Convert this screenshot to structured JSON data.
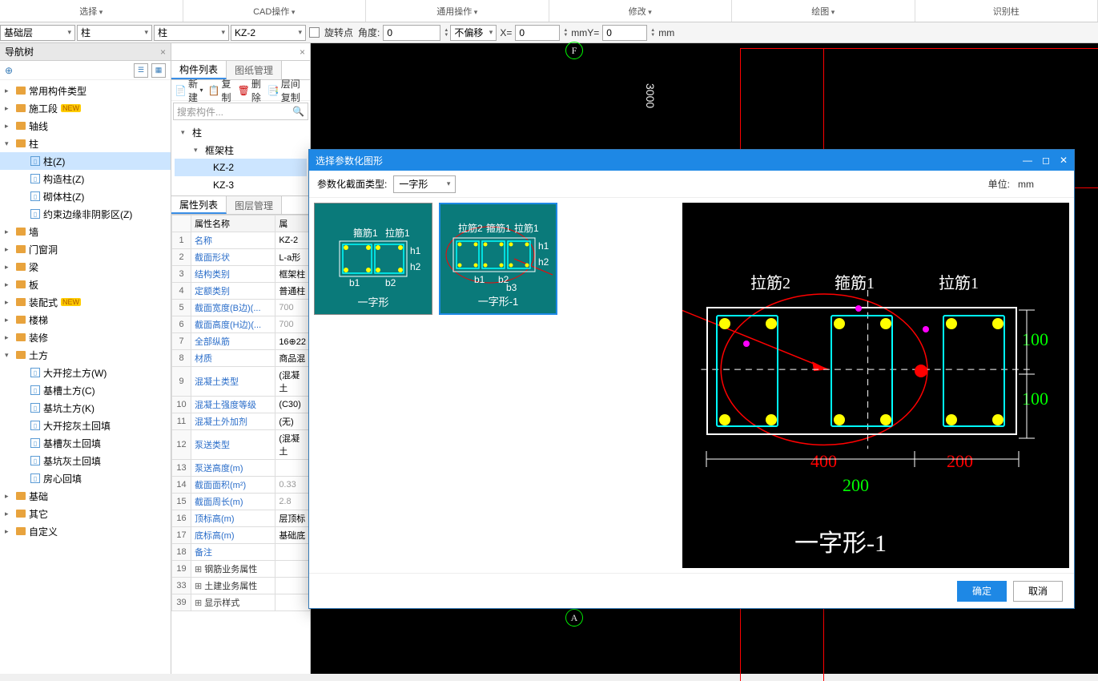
{
  "ribbon": {
    "sections": [
      "选择",
      "CAD操作",
      "通用操作",
      "修改",
      "绘图",
      "识别柱"
    ]
  },
  "toolbar": {
    "combo_floor": "基础层",
    "combo_cat1": "柱",
    "combo_cat2": "柱",
    "combo_comp": "KZ-2",
    "lbl_rotate": "旋转点",
    "lbl_angle": "角度:",
    "val_angle": "0",
    "combo_offset": "不偏移",
    "lbl_x": "X=",
    "val_x": "0",
    "unit_x": "mmY=",
    "val_y": "0",
    "unit_y": "mm"
  },
  "nav": {
    "title": "导航树",
    "items": [
      {
        "label": "常用构件类型",
        "icon": "folder",
        "exp": "▸"
      },
      {
        "label": "施工段",
        "icon": "folder",
        "exp": "▸",
        "new": true
      },
      {
        "label": "轴线",
        "icon": "folder",
        "exp": "▸"
      },
      {
        "label": "柱",
        "icon": "folder",
        "exp": "▾",
        "children": [
          {
            "label": "柱(Z)",
            "icon": "col",
            "selected": true
          },
          {
            "label": "构造柱(Z)",
            "icon": "col"
          },
          {
            "label": "砌体柱(Z)",
            "icon": "col"
          },
          {
            "label": "约束边缘非阴影区(Z)",
            "icon": "col"
          }
        ]
      },
      {
        "label": "墙",
        "icon": "folder",
        "exp": "▸"
      },
      {
        "label": "门窗洞",
        "icon": "folder",
        "exp": "▸"
      },
      {
        "label": "梁",
        "icon": "folder",
        "exp": "▸"
      },
      {
        "label": "板",
        "icon": "folder",
        "exp": "▸"
      },
      {
        "label": "装配式",
        "icon": "folder",
        "exp": "▸",
        "new": true
      },
      {
        "label": "楼梯",
        "icon": "folder",
        "exp": "▸"
      },
      {
        "label": "装修",
        "icon": "folder",
        "exp": "▸"
      },
      {
        "label": "土方",
        "icon": "folder",
        "exp": "▾",
        "children": [
          {
            "label": "大开挖土方(W)",
            "icon": "box"
          },
          {
            "label": "基槽土方(C)",
            "icon": "box"
          },
          {
            "label": "基坑土方(K)",
            "icon": "box"
          },
          {
            "label": "大开挖灰土回填",
            "icon": "box"
          },
          {
            "label": "基槽灰土回填",
            "icon": "box"
          },
          {
            "label": "基坑灰土回填",
            "icon": "box"
          },
          {
            "label": "房心回填",
            "icon": "box"
          }
        ]
      },
      {
        "label": "基础",
        "icon": "folder",
        "exp": "▸"
      },
      {
        "label": "其它",
        "icon": "folder",
        "exp": "▸"
      },
      {
        "label": "自定义",
        "icon": "folder",
        "exp": "▸"
      }
    ]
  },
  "complist": {
    "tab1": "构件列表",
    "tab2": "图纸管理",
    "tb_new": "新建",
    "tb_copy": "复制",
    "tb_delete": "删除",
    "tb_layercopy": "层间复制",
    "search_ph": "搜索构件...",
    "root": "柱",
    "group": "框架柱",
    "items": [
      "KZ-2",
      "KZ-3"
    ]
  },
  "props": {
    "tab1": "属性列表",
    "tab2": "图层管理",
    "header1": "属性名称",
    "header2": "属",
    "rows": [
      {
        "n": "1",
        "name": "名称",
        "val": "KZ-2"
      },
      {
        "n": "2",
        "name": "截面形状",
        "val": "L-a形"
      },
      {
        "n": "3",
        "name": "结构类别",
        "val": "框架柱"
      },
      {
        "n": "4",
        "name": "定额类别",
        "val": "普通柱"
      },
      {
        "n": "5",
        "name": "截面宽度(B边)(...",
        "val": "700",
        "gray": true
      },
      {
        "n": "6",
        "name": "截面高度(H边)(...",
        "val": "700",
        "gray": true
      },
      {
        "n": "7",
        "name": "全部纵筋",
        "val": "16⊕22"
      },
      {
        "n": "8",
        "name": "材质",
        "val": "商品混"
      },
      {
        "n": "9",
        "name": "混凝土类型",
        "val": "(混凝土"
      },
      {
        "n": "10",
        "name": "混凝土强度等级",
        "val": "(C30)"
      },
      {
        "n": "11",
        "name": "混凝土外加剂",
        "val": "(无)"
      },
      {
        "n": "12",
        "name": "泵送类型",
        "val": "(混凝土"
      },
      {
        "n": "13",
        "name": "泵送高度(m)",
        "val": ""
      },
      {
        "n": "14",
        "name": "截面面积(m²)",
        "val": "0.33",
        "gray": true
      },
      {
        "n": "15",
        "name": "截面周长(m)",
        "val": "2.8",
        "gray": true
      },
      {
        "n": "16",
        "name": "顶标高(m)",
        "val": "层顶标"
      },
      {
        "n": "17",
        "name": "底标高(m)",
        "val": "基础底"
      },
      {
        "n": "18",
        "name": "备注",
        "val": ""
      },
      {
        "n": "19",
        "name": "钢筋业务属性",
        "val": "",
        "expand": true
      },
      {
        "n": "33",
        "name": "土建业务属性",
        "val": "",
        "expand": true
      },
      {
        "n": "39",
        "name": "显示样式",
        "val": "",
        "expand": true
      }
    ]
  },
  "canvas": {
    "axis_f": "F",
    "axis_a": "A",
    "dim_3000": "3000"
  },
  "dialog": {
    "title": "选择参数化图形",
    "lbl_type": "参数化截面类型:",
    "combo_type": "一字形",
    "lbl_unit": "单位:",
    "val_unit": "mm",
    "thumb1": "一字形",
    "thumb2": "一字形-1",
    "thumb_labels": {
      "b1": "b1",
      "b2": "b2",
      "h1": "h1",
      "h2": "h2",
      "gu1": "箍筋1",
      "la1": "拉筋1",
      "la2": "拉筋2"
    },
    "preview": {
      "lbl_la2": "拉筋2",
      "lbl_gu1": "箍筋1",
      "lbl_la1": "拉筋1",
      "dim_400": "400",
      "dim_200a": "200",
      "dim_200b": "200",
      "dim_100a": "100",
      "dim_100b": "100",
      "section_name": "一字形-1"
    },
    "btn_ok": "确定",
    "btn_cancel": "取消"
  }
}
